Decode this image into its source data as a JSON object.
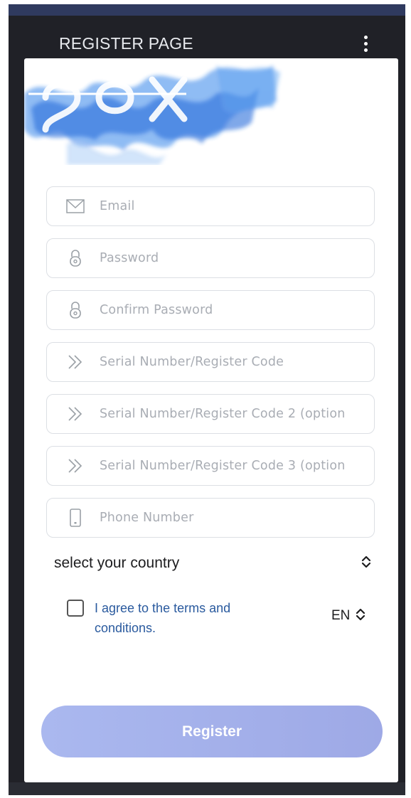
{
  "header": {
    "title": "REGISTER PAGE",
    "menu_icon": "kebab-menu-icon"
  },
  "form": {
    "fields": [
      {
        "name": "email",
        "placeholder": "Email",
        "value": "",
        "icon": "mail-icon"
      },
      {
        "name": "password",
        "placeholder": "Password",
        "value": "",
        "icon": "lock-icon"
      },
      {
        "name": "confirm-password",
        "placeholder": "Confirm Password",
        "value": "",
        "icon": "lock-icon"
      },
      {
        "name": "serial-1",
        "placeholder": "Serial Number/Register Code",
        "value": "",
        "icon": "double-chevron-icon"
      },
      {
        "name": "serial-2",
        "placeholder": "Serial Number/Register Code 2 (option",
        "value": "",
        "icon": "double-chevron-icon"
      },
      {
        "name": "serial-3",
        "placeholder": "Serial Number/Register Code 3 (option",
        "value": "",
        "icon": "double-chevron-icon"
      },
      {
        "name": "phone",
        "placeholder": "Phone Number",
        "value": "",
        "icon": "phone-icon"
      }
    ],
    "country_select": {
      "label": "select your country"
    },
    "terms": {
      "label": "I agree to the terms and conditions.",
      "checked": false
    },
    "language": {
      "value": "EN"
    },
    "register_label": "Register"
  },
  "colors": {
    "frame": "#202127",
    "accent_button": "#a4b1ec",
    "terms_link": "#2a5a9e",
    "logo_blue": "#2a7de8"
  }
}
